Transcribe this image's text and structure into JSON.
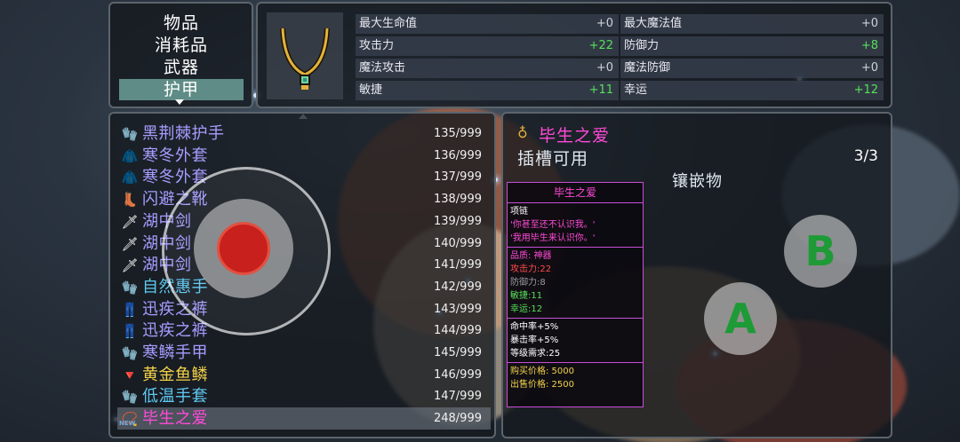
{
  "categories": {
    "items": [
      "物品",
      "消耗品",
      "武器",
      "护甲"
    ],
    "selected_index": 3
  },
  "stats": {
    "left": [
      {
        "label": "最大生命值",
        "value": "+0",
        "positive": false
      },
      {
        "label": "攻击力",
        "value": "+22",
        "positive": true
      },
      {
        "label": "魔法攻击",
        "value": "+0",
        "positive": false
      },
      {
        "label": "敏捷",
        "value": "+11",
        "positive": true
      }
    ],
    "right": [
      {
        "label": "最大魔法值",
        "value": "+0",
        "positive": false
      },
      {
        "label": "防御力",
        "value": "+8",
        "positive": true
      },
      {
        "label": "魔法防御",
        "value": "+0",
        "positive": false
      },
      {
        "label": "幸运",
        "value": "+12",
        "positive": true
      }
    ]
  },
  "inventory": [
    {
      "icon": "gauntlet-icon",
      "glyph": "🧤",
      "name": "黑荆棘护手",
      "count": "135/999",
      "color": "purple"
    },
    {
      "icon": "coat-icon",
      "glyph": "🧥",
      "name": "寒冬外套",
      "count": "136/999",
      "color": "purple"
    },
    {
      "icon": "coat-icon",
      "glyph": "🧥",
      "name": "寒冬外套",
      "count": "137/999",
      "color": "purple"
    },
    {
      "icon": "boot-icon",
      "glyph": "👢",
      "name": "闪避之靴",
      "count": "138/999",
      "color": "purple"
    },
    {
      "icon": "sword-icon",
      "glyph": "🗡",
      "name": "湖中剑",
      "count": "139/999",
      "color": "purple"
    },
    {
      "icon": "sword-icon",
      "glyph": "🗡",
      "name": "湖中剑",
      "count": "140/999",
      "color": "purple"
    },
    {
      "icon": "sword-icon",
      "glyph": "🗡",
      "name": "湖中剑",
      "count": "141/999",
      "color": "purple"
    },
    {
      "icon": "gauntlet-icon",
      "glyph": "🧤",
      "name": "自然惠手",
      "count": "142/999",
      "color": "cyan"
    },
    {
      "icon": "leggings-icon",
      "glyph": "👖",
      "name": "迅疾之裤",
      "count": "143/999",
      "color": "purple"
    },
    {
      "icon": "leggings-icon",
      "glyph": "👖",
      "name": "迅疾之裤",
      "count": "144/999",
      "color": "purple"
    },
    {
      "icon": "gauntlet-icon",
      "glyph": "🧤",
      "name": "寒鳞手甲",
      "count": "145/999",
      "color": "purple"
    },
    {
      "icon": "scale-icon",
      "glyph": "🔻",
      "name": "黄金鱼鳞",
      "count": "146/999",
      "color": "yellow"
    },
    {
      "icon": "glove-icon",
      "glyph": "🧤",
      "name": "低温手套",
      "count": "147/999",
      "color": "cyan"
    },
    {
      "icon": "necklace-icon",
      "glyph": "📿",
      "name": "毕生之爱",
      "count": "248/999",
      "color": "magenta",
      "selected": true,
      "new": "NEW"
    }
  ],
  "detail": {
    "title": "毕生之爱",
    "slot_text": "插槽可用",
    "slot_count": "3/3",
    "inlay_label": "镶嵌物"
  },
  "card": {
    "title": "毕生之爱",
    "type": "项链",
    "quote1": "'你甚至还不认识我。'",
    "quote2": "'我用毕生来认识你。'",
    "quality": "品质: 神器",
    "attack": "攻击力:22",
    "defense": "防御力:8",
    "agility": "敏捷:11",
    "luck": "幸运:12",
    "hit": "命中率+5%",
    "crit": "暴击率+5%",
    "level_req": "等级需求:25",
    "buy_price": "购买价格: 5000",
    "sell_price": "出售价格: 2500"
  },
  "buttons": {
    "a": "A",
    "b": "B"
  }
}
